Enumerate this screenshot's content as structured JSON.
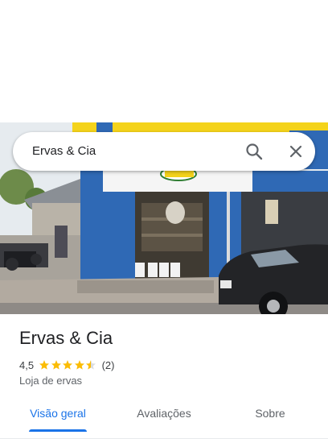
{
  "search": {
    "query": "Ervas & Cia"
  },
  "icons": {
    "search": "search-icon",
    "close": "close-icon",
    "star": "star-icon"
  },
  "colors": {
    "accent": "#1a73e8",
    "star": "#fbbc04",
    "storefront": "#2f69b5",
    "sign": "#f4d31b"
  },
  "place": {
    "name": "Ervas & Cia",
    "rating": "4,5",
    "stars_value": 4.5,
    "stars_max": 5,
    "reviews": "(2)",
    "category": "Loja de ervas"
  },
  "tabs": [
    {
      "label": "Visão geral",
      "active": true
    },
    {
      "label": "Avaliações",
      "active": false
    },
    {
      "label": "Sobre",
      "active": false
    }
  ]
}
